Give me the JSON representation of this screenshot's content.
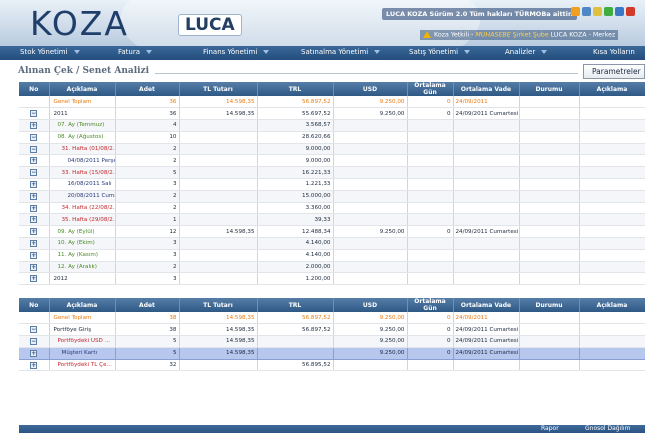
{
  "header": {
    "logo_koza": "KOZA",
    "logo_luca": "LUCA",
    "info": "LUCA KOZA Sürüm 2.0 Tüm hakları TÜRMOBa aittir.",
    "user_label": "Koza Yetkili - ",
    "user_role": "MUHASEBE",
    "user_sep": "  Şirket Şube",
    "user_company": "LUCA KOZA - Merkez"
  },
  "menu": [
    "Stok Yönetimi",
    "Fatura",
    "Finans Yönetimi",
    "Satınalma Yönetimi",
    "Satış Yönetimi",
    "Analizler",
    "Kısa Yolların"
  ],
  "page": {
    "title": "Alınan Çek / Senet Analizi",
    "params_button": "Parametreler"
  },
  "columns": [
    "No",
    "Açıklama",
    "Adet",
    "TL Tutarı",
    "TRL",
    "USD",
    "Ortalama Gün",
    "Ortalama Vade",
    "Durumu",
    "Açıklama"
  ],
  "table1": [
    {
      "cls": "row-total",
      "exp": "",
      "lvl": "lvl1",
      "desc": "Genel Toplam",
      "adet": "36",
      "tl": "14.598,35",
      "trl": "56.897,52",
      "usd": "9.250,00",
      "gun": "0",
      "vade": "24/09/2011",
      "durum": "",
      "acik": ""
    },
    {
      "cls": "row-year",
      "exp": "−",
      "lvl": "lvl1",
      "desc": "2011",
      "adet": "36",
      "tl": "14.598,35",
      "trl": "55.697,52",
      "usd": "9.250,00",
      "gun": "0",
      "vade": "24/09/2011 Cumartesi",
      "durum": "",
      "acik": ""
    },
    {
      "cls": "row-month row-alt",
      "exp": "+",
      "lvl": "lvl2",
      "desc": "07. Ay (Temmuz)",
      "adet": "4",
      "tl": "",
      "trl": "3.568,57",
      "usd": "",
      "gun": "",
      "vade": "",
      "durum": "",
      "acik": ""
    },
    {
      "cls": "row-month",
      "exp": "−",
      "lvl": "lvl2",
      "desc": "08. Ay (Ağustos)",
      "adet": "10",
      "tl": "",
      "trl": "28.620,66",
      "usd": "",
      "gun": "",
      "vade": "",
      "durum": "",
      "acik": ""
    },
    {
      "cls": "row-week row-alt",
      "exp": "−",
      "lvl": "lvl3",
      "desc": "31. Hafta (01/08/2...",
      "adet": "2",
      "tl": "",
      "trl": "9.000,00",
      "usd": "",
      "gun": "",
      "vade": "",
      "durum": "",
      "acik": ""
    },
    {
      "cls": "row-day",
      "exp": "+",
      "lvl": "lvl4",
      "desc": "04/08/2011 Perşe...",
      "adet": "2",
      "tl": "",
      "trl": "9.000,00",
      "usd": "",
      "gun": "",
      "vade": "",
      "durum": "",
      "acik": ""
    },
    {
      "cls": "row-week row-alt",
      "exp": "−",
      "lvl": "lvl3",
      "desc": "33. Hafta (15/08/2...",
      "adet": "5",
      "tl": "",
      "trl": "16.221,33",
      "usd": "",
      "gun": "",
      "vade": "",
      "durum": "",
      "acik": ""
    },
    {
      "cls": "row-day",
      "exp": "+",
      "lvl": "lvl4",
      "desc": "16/08/2011 Salı",
      "adet": "3",
      "tl": "",
      "trl": "1.221,33",
      "usd": "",
      "gun": "",
      "vade": "",
      "durum": "",
      "acik": ""
    },
    {
      "cls": "row-day row-alt",
      "exp": "+",
      "lvl": "lvl4",
      "desc": "20/08/2011 Cuma...",
      "adet": "2",
      "tl": "",
      "trl": "15.000,00",
      "usd": "",
      "gun": "",
      "vade": "",
      "durum": "",
      "acik": ""
    },
    {
      "cls": "row-week",
      "exp": "+",
      "lvl": "lvl3",
      "desc": "34. Hafta (22/08/2...",
      "adet": "2",
      "tl": "",
      "trl": "3.360,00",
      "usd": "",
      "gun": "",
      "vade": "",
      "durum": "",
      "acik": ""
    },
    {
      "cls": "row-week row-alt",
      "exp": "+",
      "lvl": "lvl3",
      "desc": "35. Hafta (29/08/2...",
      "adet": "1",
      "tl": "",
      "trl": "39,33",
      "usd": "",
      "gun": "",
      "vade": "",
      "durum": "",
      "acik": ""
    },
    {
      "cls": "row-month",
      "exp": "+",
      "lvl": "lvl2",
      "desc": "09. Ay (Eylül)",
      "adet": "12",
      "tl": "14.598,35",
      "trl": "12.488,34",
      "usd": "9.250,00",
      "gun": "0",
      "vade": "24/09/2011 Cumartesi",
      "durum": "",
      "acik": ""
    },
    {
      "cls": "row-month row-alt",
      "exp": "+",
      "lvl": "lvl2",
      "desc": "10. Ay (Ekim)",
      "adet": "3",
      "tl": "",
      "trl": "4.140,00",
      "usd": "",
      "gun": "",
      "vade": "",
      "durum": "",
      "acik": ""
    },
    {
      "cls": "row-month",
      "exp": "+",
      "lvl": "lvl2",
      "desc": "11. Ay (Kasım)",
      "adet": "3",
      "tl": "",
      "trl": "4.140,00",
      "usd": "",
      "gun": "",
      "vade": "",
      "durum": "",
      "acik": ""
    },
    {
      "cls": "row-month row-alt",
      "exp": "+",
      "lvl": "lvl2",
      "desc": "12. Ay (Aralık)",
      "adet": "2",
      "tl": "",
      "trl": "2.000,00",
      "usd": "",
      "gun": "",
      "vade": "",
      "durum": "",
      "acik": ""
    },
    {
      "cls": "row-year",
      "exp": "+",
      "lvl": "lvl1",
      "desc": "2012",
      "adet": "3",
      "tl": "",
      "trl": "1.200,00",
      "usd": "",
      "gun": "",
      "vade": "",
      "durum": "",
      "acik": ""
    }
  ],
  "table2": [
    {
      "cls": "row-total",
      "exp": "",
      "lvl": "lvl1",
      "desc": "Genel Toplam",
      "adet": "38",
      "tl": "14.598,35",
      "trl": "56.897,52",
      "usd": "9.250,00",
      "gun": "0",
      "vade": "24/09/2011",
      "durum": "",
      "acik": ""
    },
    {
      "cls": "row-year",
      "exp": "−",
      "lvl": "lvl1",
      "desc": "Portföye Giriş",
      "adet": "38",
      "tl": "14.598,35",
      "trl": "56.897,52",
      "usd": "9.250,00",
      "gun": "0",
      "vade": "24/09/2011 Cumartesi",
      "durum": "",
      "acik": ""
    },
    {
      "cls": "row-sub row-alt",
      "exp": "−",
      "lvl": "lvl2",
      "desc": "Portföydeki USD ...",
      "adet": "5",
      "tl": "14.598,35",
      "trl": "",
      "usd": "9.250,00",
      "gun": "0",
      "vade": "24/09/2011 Cumartesi",
      "durum": "",
      "acik": ""
    },
    {
      "cls": "row-day row-sel",
      "exp": "+",
      "lvl": "lvl3",
      "desc": "Müşteri Kartı",
      "adet": "5",
      "tl": "14.598,35",
      "trl": "",
      "usd": "9.250,00",
      "gun": "0",
      "vade": "24/09/2011 Cumartesi",
      "durum": "",
      "acik": ""
    },
    {
      "cls": "row-sub",
      "exp": "+",
      "lvl": "lvl2",
      "desc": "Portföydeki TL Çe...",
      "adet": "32",
      "tl": "",
      "trl": "56.895,52",
      "usd": "",
      "gun": "",
      "vade": "",
      "durum": "",
      "acik": ""
    }
  ],
  "bottom": {
    "btn1": "Rapor",
    "btn2": "Gnosol Dağılım"
  }
}
